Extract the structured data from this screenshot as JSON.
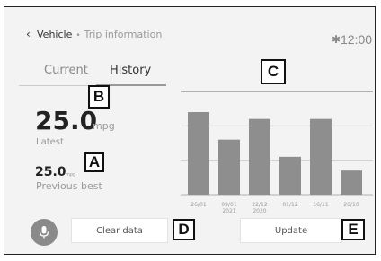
{
  "header": {
    "back_icon": "chevron-left-icon",
    "title": "Vehicle",
    "separator": "•",
    "subtitle": "Trip information",
    "bluetooth_icon": "bluetooth-icon",
    "time": "12:00"
  },
  "tabs": [
    {
      "label": "Current",
      "active": false
    },
    {
      "label": "History",
      "active": true
    }
  ],
  "stats": {
    "latest": {
      "value": "25.0",
      "unit": "mpg",
      "label": "Latest"
    },
    "best": {
      "value": "25.0",
      "unit": "mpg",
      "label": "Previous best"
    }
  },
  "callouts": {
    "a": "A",
    "b": "B",
    "c": "C",
    "d": "D",
    "e": "E"
  },
  "buttons": {
    "mic_icon": "microphone-icon",
    "clear": "Clear data",
    "update": "Update"
  },
  "colors": {
    "bar": "#8e8e8e",
    "background": "#f3f3f3",
    "accent": "#8a8a8a"
  },
  "chart_data": {
    "type": "bar",
    "unit_label": "MP",
    "categories": [
      "26/01",
      "09/01\n2021",
      "22/12\n2020",
      "01/12",
      "16/11",
      "26/10"
    ],
    "category_lines": [
      [
        "26/01"
      ],
      [
        "09/01",
        "2021"
      ],
      [
        "22/12",
        "2020"
      ],
      [
        "01/12"
      ],
      [
        "16/11"
      ],
      [
        "26/10"
      ]
    ],
    "values": [
      24,
      16,
      22,
      11,
      22,
      7
    ],
    "yticks": [
      10,
      20,
      30
    ],
    "ylim": [
      0,
      30
    ],
    "grid": true
  }
}
